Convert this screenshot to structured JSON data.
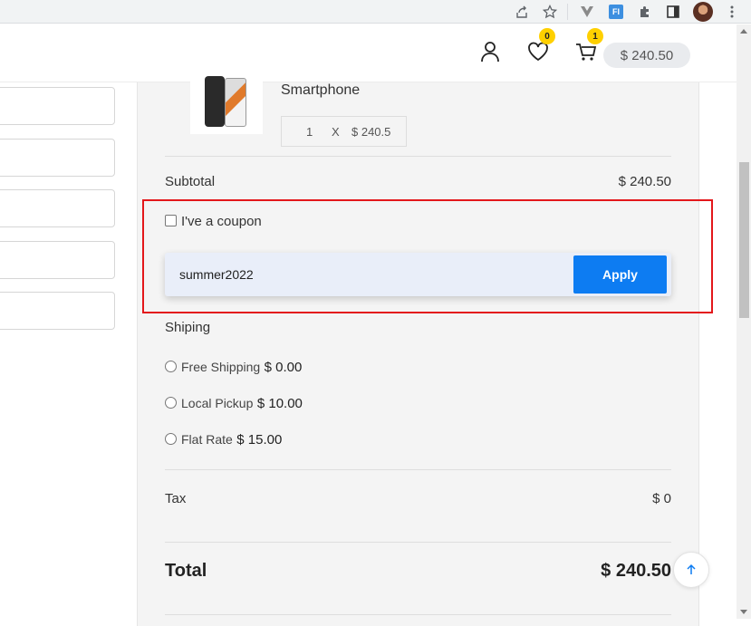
{
  "browser": {
    "icons": [
      "share-icon",
      "star-icon",
      "vue-devtools-icon",
      "fi-extension-icon",
      "puzzle-icon",
      "side-panel-icon",
      "profile-avatar",
      "kebab-menu-icon"
    ],
    "fi_label": "FI"
  },
  "header": {
    "wishlist_count": "0",
    "cart_count": "1",
    "cart_total": "$ 240.50"
  },
  "product": {
    "name": "Smartphone",
    "qty": "1",
    "times": "X",
    "price": "$ 240.5"
  },
  "summary": {
    "subtotal_label": "Subtotal",
    "subtotal_value": "$ 240.50",
    "coupon_label": "I've a coupon",
    "coupon_value": "summer2022",
    "apply_label": "Apply",
    "shipping_label": "Shiping",
    "shipping_options": [
      {
        "label": "Free Shipping",
        "price": "$ 0.00"
      },
      {
        "label": "Local Pickup",
        "price": "$ 10.00"
      },
      {
        "label": "Flat Rate",
        "price": "$ 15.00"
      }
    ],
    "tax_label": "Tax",
    "tax_value": "$ 0",
    "total_label": "Total",
    "total_value": "$ 240.50"
  },
  "colors": {
    "accent": "#0d7cf2",
    "badge": "#ffd000",
    "highlight": "#e3171b"
  }
}
